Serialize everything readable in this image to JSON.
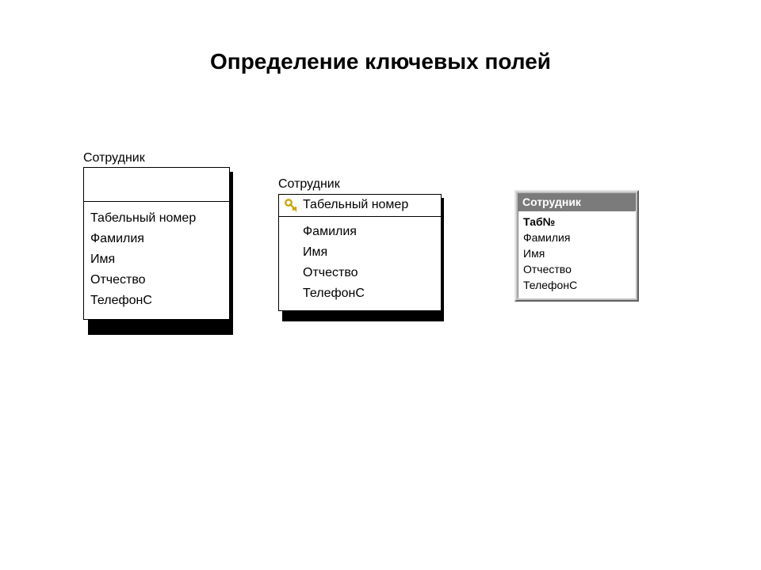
{
  "title": "Определение ключевых полей",
  "table1": {
    "label": "Сотрудник",
    "fields": [
      "Табельный номер",
      "Фамилия",
      "Имя",
      "Отчество",
      "ТелефонС"
    ]
  },
  "table2": {
    "label": "Сотрудник",
    "key_field": "Табельный номер",
    "fields": [
      "Фамилия",
      "Имя",
      "Отчество",
      "ТелефонС"
    ]
  },
  "table3": {
    "header": "Сотрудник",
    "key_field": "Таб№",
    "fields": [
      "Фамилия",
      "Имя",
      "Отчество",
      "ТелефонС"
    ]
  },
  "colors": {
    "table3_frame": "#c0c0c0",
    "table3_header_bg": "#7b7b7b",
    "table3_header_fg": "#ffffff"
  }
}
